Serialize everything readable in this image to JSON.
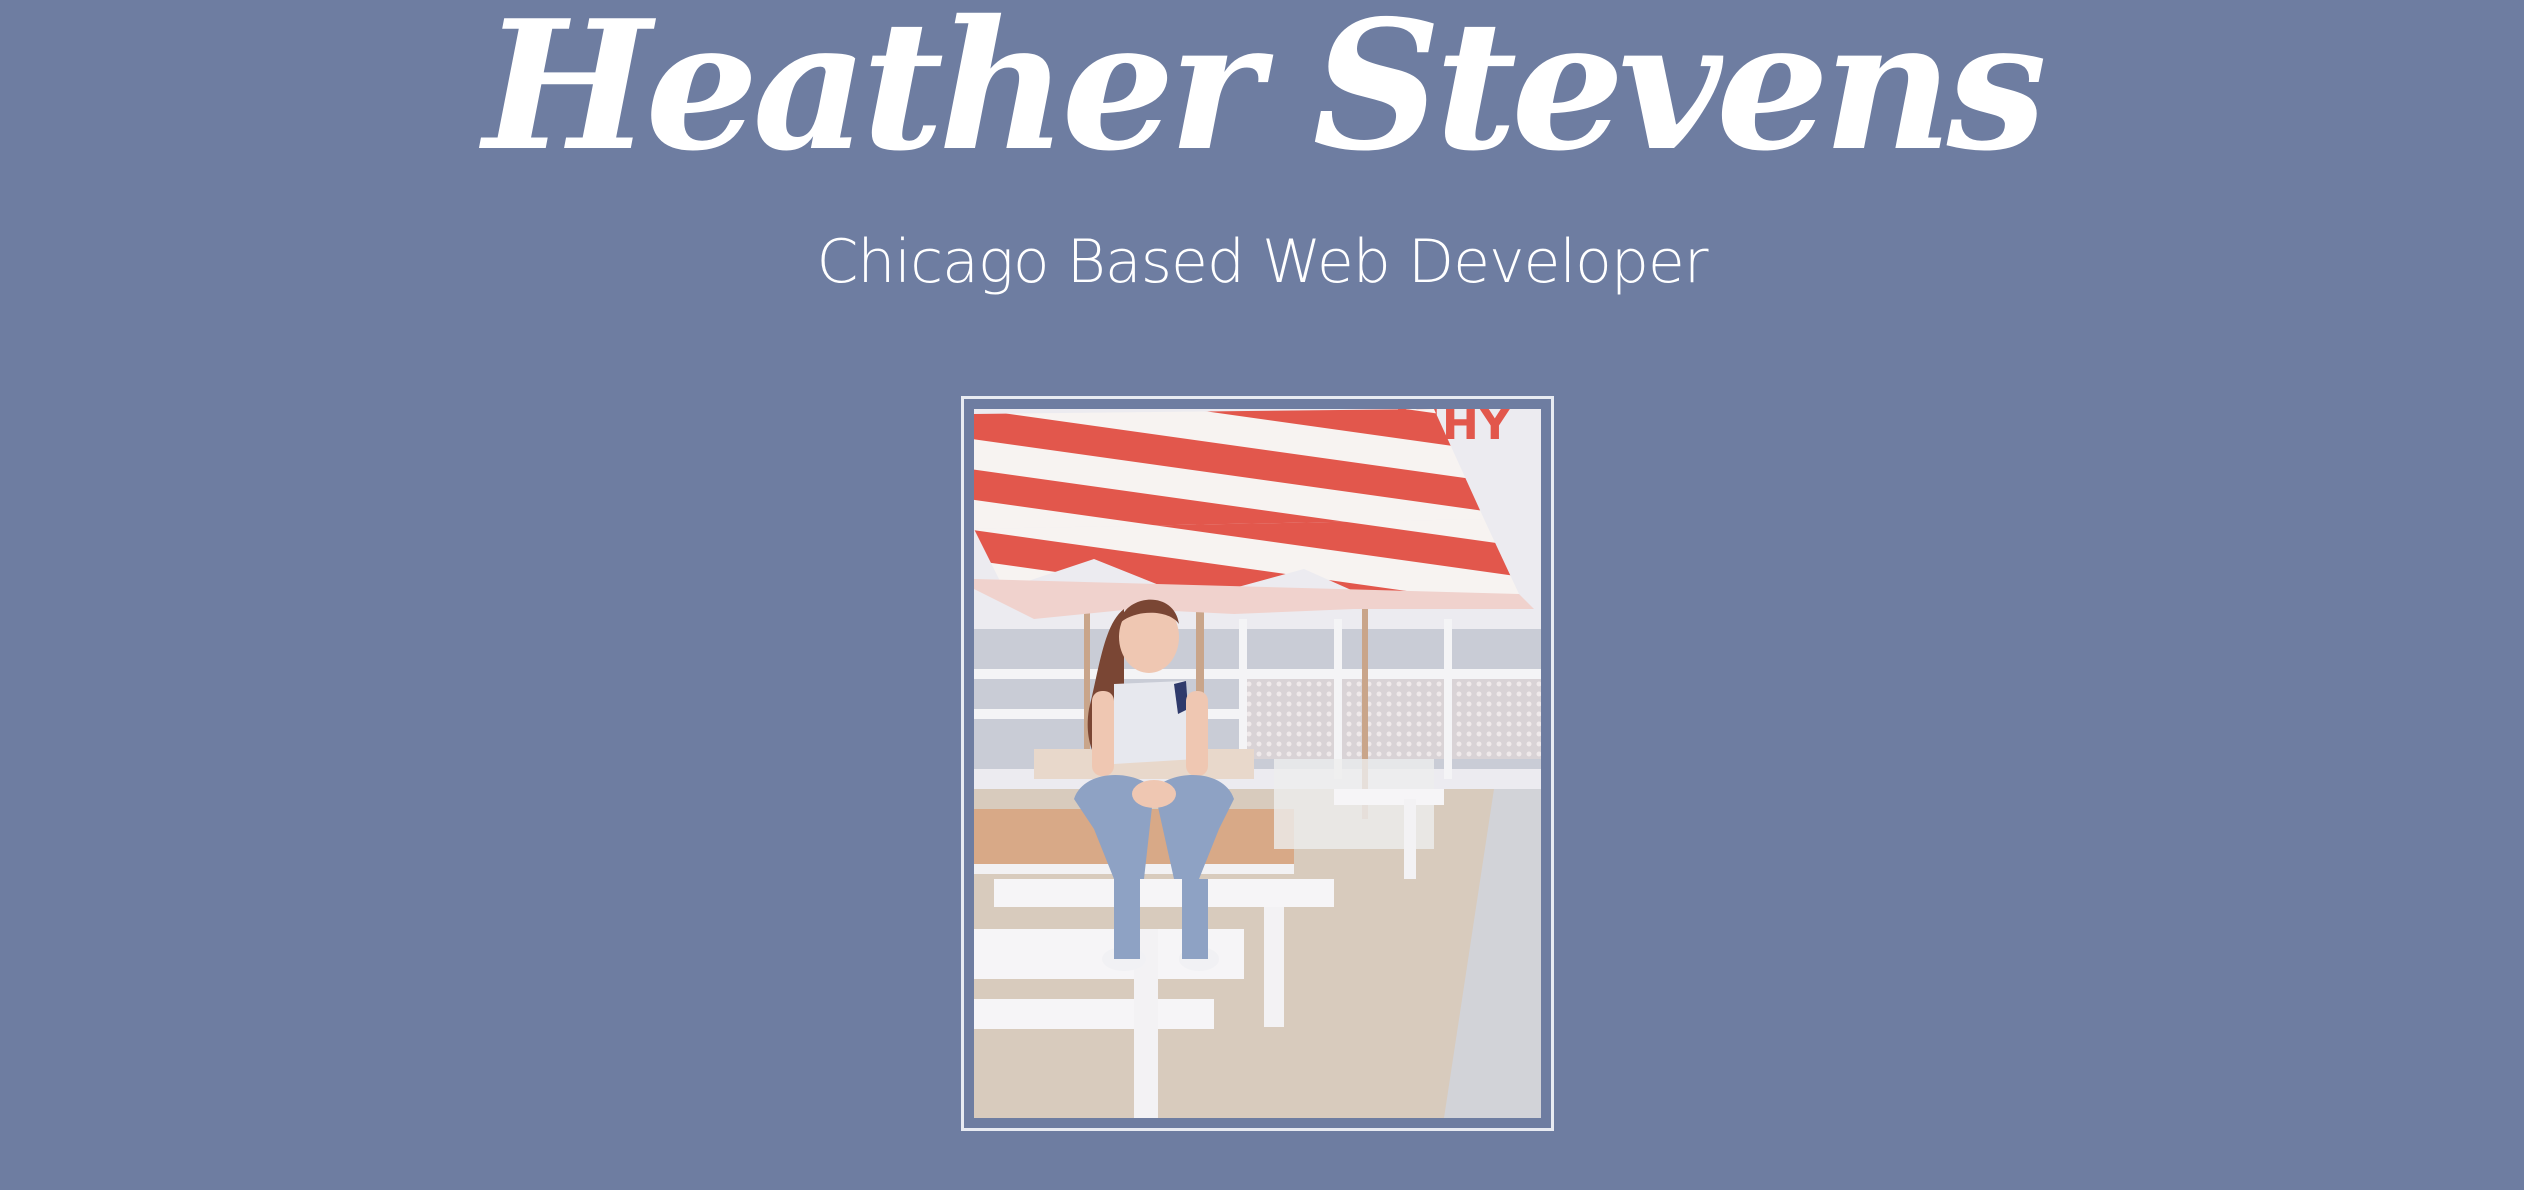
{
  "hero": {
    "title": "Heather Stevens",
    "subtitle": "Chicago Based Web Developer"
  },
  "portrait": {
    "alt": "Portrait photo",
    "sign_text": "ISHY"
  },
  "colors": {
    "background": "#6e7da1",
    "text": "#ffffff",
    "frame_border": "#e8ebf2",
    "umbrella_red": "#e2574c",
    "umbrella_white": "#f7f3f1"
  }
}
